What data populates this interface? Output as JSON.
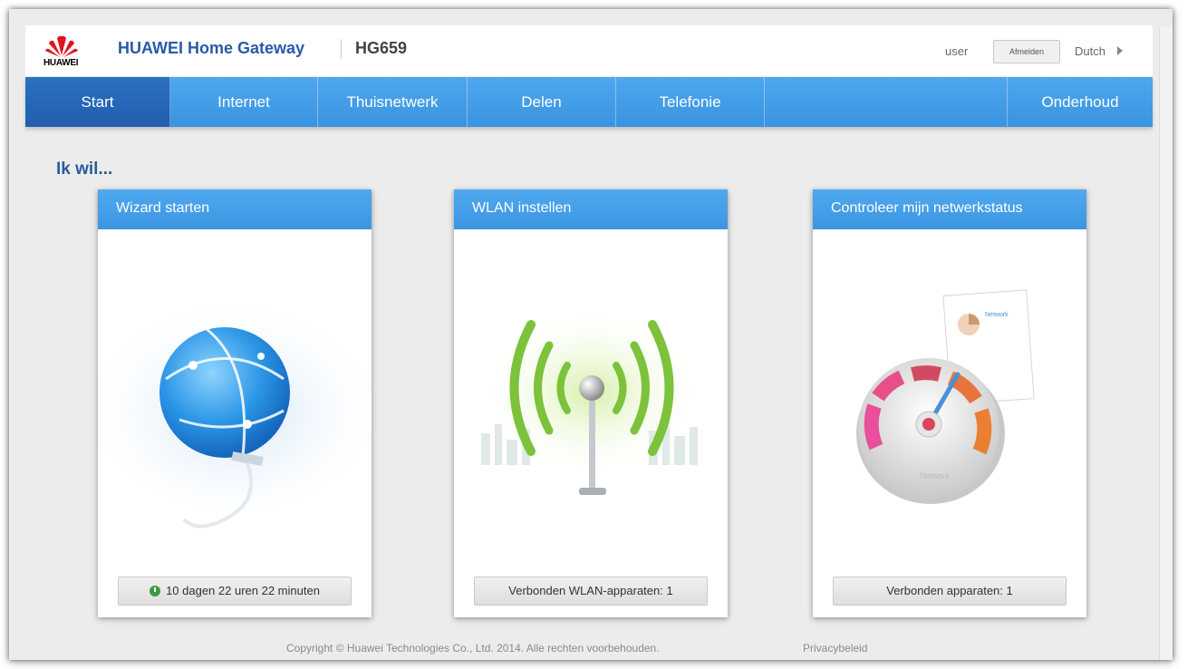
{
  "header": {
    "logo_text": "HUAWEI",
    "app_title": "HUAWEI Home Gateway",
    "model": "HG659",
    "user": "user",
    "logout_label": "Afmelden",
    "language": "Dutch"
  },
  "nav": {
    "items": [
      {
        "label": "Start"
      },
      {
        "label": "Internet"
      },
      {
        "label": "Thuisnetwerk"
      },
      {
        "label": "Delen"
      },
      {
        "label": "Telefonie"
      },
      {
        "label": "Onderhoud"
      }
    ],
    "active": "Start"
  },
  "main": {
    "section_title": "Ik wil...",
    "cards": [
      {
        "title": "Wizard starten",
        "footer": "10 dagen 22 uren 22 minuten"
      },
      {
        "title": "WLAN instellen",
        "footer": "Verbonden WLAN-apparaten: 1"
      },
      {
        "title": "Controleer mijn netwerkstatus",
        "footer": "Verbonden apparaten: 1",
        "doc_title": "Network",
        "gauge_label": "Network"
      }
    ]
  },
  "footer": {
    "copyright": "Copyright © Huawei Technologies Co., Ltd. 2014. Alle rechten voorbehouden.",
    "privacy": "Privacybeleid"
  },
  "colors": {
    "nav_blue": "#3a93e0",
    "nav_active": "#225ead",
    "title_blue": "#2a5aa8",
    "huawei_red": "#e0141e",
    "wifi_green": "#7cc23a"
  }
}
